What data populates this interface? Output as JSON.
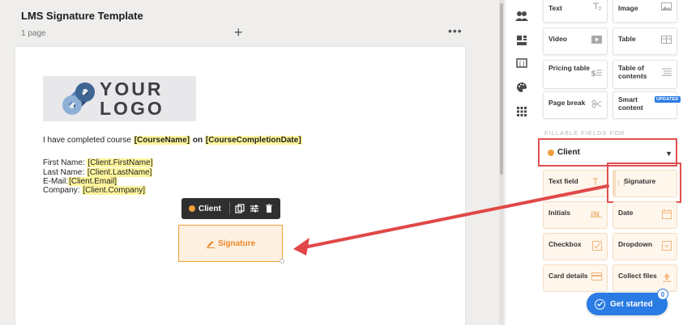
{
  "document": {
    "title": "LMS Signature Template",
    "pages": "1 page",
    "add_label": "+",
    "more_label": "•••",
    "logo_text_line1": "YOUR",
    "logo_text_line2": "LOGO",
    "course_prefix": "I have completed course",
    "course_token": "[CourseName]",
    "course_on": "on",
    "course_date_token": "[CourseCompletionDate]",
    "fields": [
      {
        "label": "First Name:",
        "token": "[Client.FirstName]"
      },
      {
        "label": "Last Name:",
        "token": "[Client.LastName]"
      },
      {
        "label": "E-Mail:",
        "token": "[Client.Email]"
      },
      {
        "label": "Company:",
        "token": "[Client.Company]"
      }
    ],
    "field_toolbar": {
      "role": "Client"
    },
    "signature_field": {
      "label": "Signature"
    }
  },
  "rail": {
    "icons": [
      "users-icon",
      "blocks-icon",
      "variables-icon",
      "palette-icon",
      "apps-icon"
    ]
  },
  "content_blocks": {
    "text": "Text",
    "image": "Image",
    "video": "Video",
    "table": "Table",
    "pricing_table": "Pricing table",
    "table_of_contents": "Table of contents",
    "page_break": "Page break",
    "smart_content": "Smart content",
    "smart_badge": "UPDATED"
  },
  "fillable": {
    "section_label": "FILLABLE FIELDS FOR",
    "role": "Client",
    "role_color": "#f0a03c",
    "items": {
      "text_field": "Text field",
      "signature": "Signature",
      "initials": "Initials",
      "date": "Date",
      "checkbox": "Checkbox",
      "dropdown": "Dropdown",
      "card_details": "Card details",
      "collect_files": "Collect files"
    }
  },
  "get_started": {
    "label": "Get started",
    "count": "0"
  },
  "colors": {
    "accent": "#2a7be4",
    "field_orange": "#f0a03c",
    "highlight_red": "#e05050",
    "token_yellow": "#fff59d"
  }
}
